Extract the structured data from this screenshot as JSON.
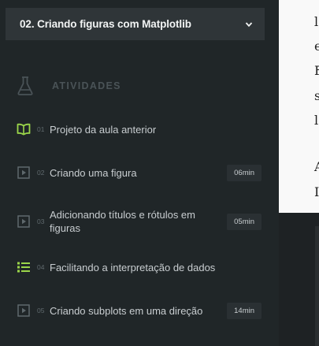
{
  "sidebar": {
    "course_title": "02. Criando figuras com Matplotlib",
    "activities_label": "ATIVIDADES",
    "items": [
      {
        "number": "01",
        "label": "Projeto da aula anterior",
        "duration": "",
        "icon": "open-book-icon"
      },
      {
        "number": "02",
        "label": "Criando uma figura",
        "duration": "06min",
        "icon": "video-play-icon"
      },
      {
        "number": "03",
        "label": "Adicionando títulos e rótulos em figuras",
        "duration": "05min",
        "icon": "video-play-icon"
      },
      {
        "number": "04",
        "label": "Facilitando a interpretação de dados",
        "duration": "",
        "icon": "list-icon"
      },
      {
        "number": "05",
        "label": "Criando subplots em uma direção",
        "duration": "14min",
        "icon": "video-play-icon"
      }
    ]
  },
  "content": {
    "visible_letters": [
      "l",
      "e",
      "F",
      "s",
      "l",
      "A",
      "I"
    ]
  },
  "colors": {
    "sidebar_bg": "#202628",
    "select_bg": "#2f3538",
    "accent_green": "#9bd64a",
    "muted_icon": "#5f696d"
  }
}
